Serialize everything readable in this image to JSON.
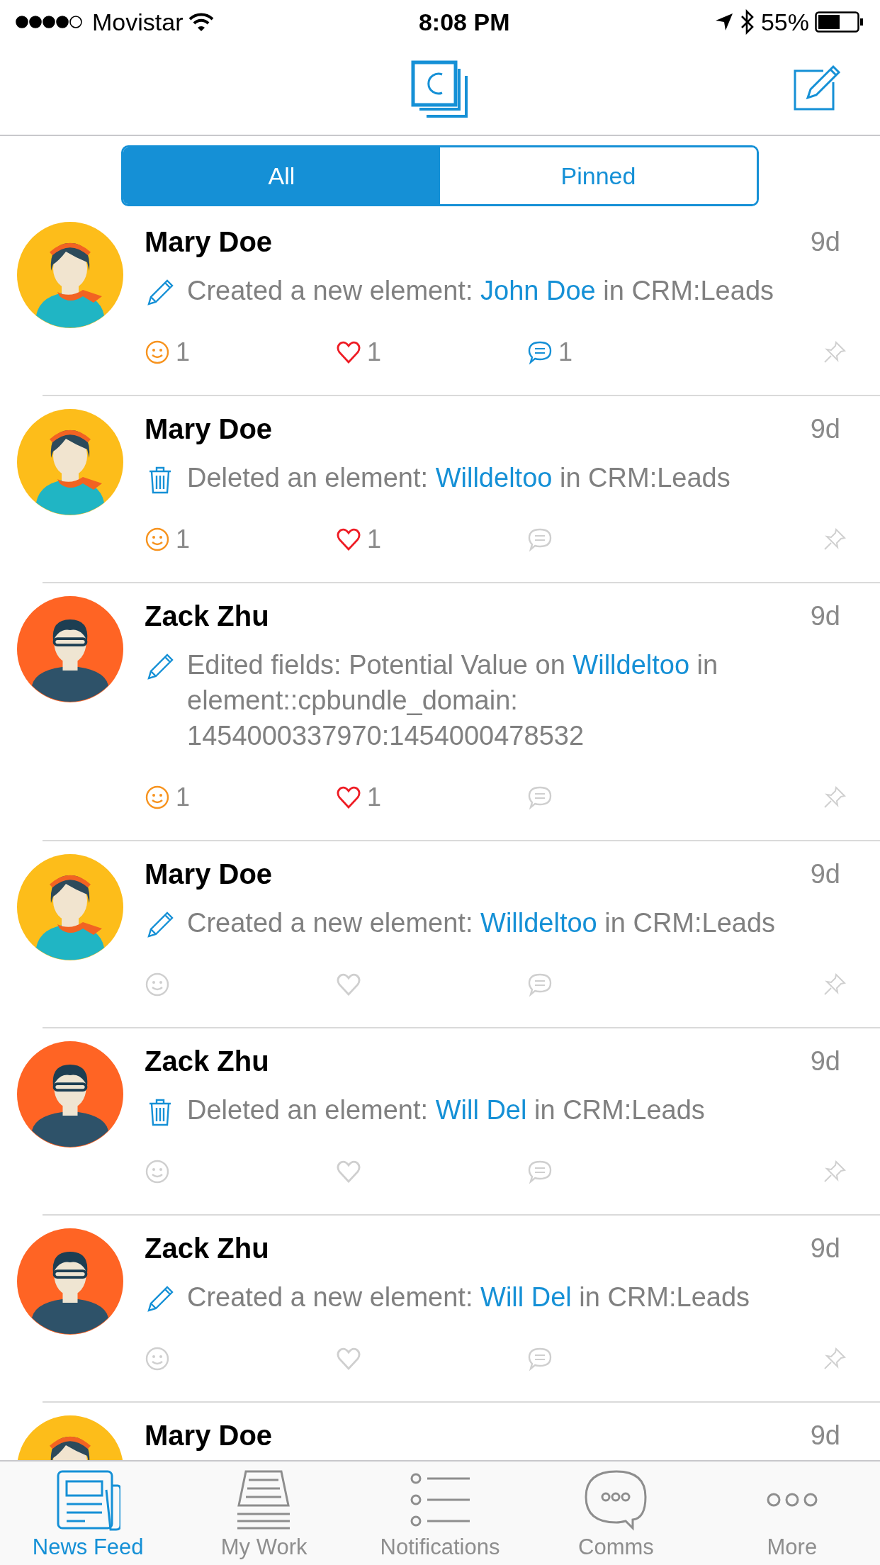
{
  "status_bar": {
    "carrier": "Movistar",
    "time": "8:08 PM",
    "battery": "55%"
  },
  "segments": [
    {
      "label": "All",
      "selected": true
    },
    {
      "label": "Pinned",
      "selected": false
    }
  ],
  "feed": [
    {
      "author": "Mary Doe",
      "avatar": {
        "kind": "woman"
      },
      "time": "9d",
      "activity": {
        "kind": "edit",
        "before": "Created a new element: ",
        "link": "John Doe",
        "after": " in CRM:Leads"
      },
      "reactions": [
        {
          "kind": "smile",
          "active": true,
          "count": "1"
        },
        {
          "kind": "heart",
          "active": true,
          "count": "1"
        },
        {
          "kind": "comment",
          "active": true,
          "count": "1"
        },
        {
          "kind": "pin",
          "active": false
        }
      ]
    },
    {
      "author": "Mary Doe",
      "avatar": {
        "kind": "woman"
      },
      "time": "9d",
      "activity": {
        "kind": "delete",
        "before": "Deleted an element: ",
        "link": "Willdeltoo",
        "after": " in CRM:Leads"
      },
      "reactions": [
        {
          "kind": "smile",
          "active": true,
          "count": "1"
        },
        {
          "kind": "heart",
          "active": true,
          "count": "1"
        },
        {
          "kind": "comment",
          "active": false
        },
        {
          "kind": "pin",
          "active": false
        }
      ]
    },
    {
      "author": "Zack Zhu",
      "avatar": {
        "kind": "man"
      },
      "time": "9d",
      "activity": {
        "kind": "edit",
        "before": "Edited fields: Potential Value on ",
        "link": "Willdeltoo",
        "after": " in element::cpbundle_domain: 1454000337970:1454000478532"
      },
      "reactions": [
        {
          "kind": "smile",
          "active": true,
          "count": "1"
        },
        {
          "kind": "heart",
          "active": true,
          "count": "1"
        },
        {
          "kind": "comment",
          "active": false
        },
        {
          "kind": "pin",
          "active": false
        }
      ]
    },
    {
      "author": "Mary Doe",
      "avatar": {
        "kind": "woman"
      },
      "time": "9d",
      "activity": {
        "kind": "edit",
        "before": "Created a new element: ",
        "link": "Willdeltoo",
        "after": " in CRM:Leads"
      },
      "reactions": [
        {
          "kind": "smile",
          "active": false
        },
        {
          "kind": "heart",
          "active": false
        },
        {
          "kind": "comment",
          "active": false
        },
        {
          "kind": "pin",
          "active": false
        }
      ]
    },
    {
      "author": "Zack Zhu",
      "avatar": {
        "kind": "man"
      },
      "time": "9d",
      "activity": {
        "kind": "delete",
        "before": "Deleted an element: ",
        "link": "Will Del",
        "after": " in CRM:Leads"
      },
      "reactions": [
        {
          "kind": "smile",
          "active": false
        },
        {
          "kind": "heart",
          "active": false
        },
        {
          "kind": "comment",
          "active": false
        },
        {
          "kind": "pin",
          "active": false
        }
      ]
    },
    {
      "author": "Zack Zhu",
      "avatar": {
        "kind": "man"
      },
      "time": "9d",
      "activity": {
        "kind": "edit",
        "before": "Created a new element: ",
        "link": "Will Del",
        "after": " in CRM:Leads"
      },
      "reactions": [
        {
          "kind": "smile",
          "active": false
        },
        {
          "kind": "heart",
          "active": false
        },
        {
          "kind": "comment",
          "active": false
        },
        {
          "kind": "pin",
          "active": false
        }
      ]
    },
    {
      "author": "Mary Doe",
      "avatar": {
        "kind": "woman"
      },
      "time": "9d"
    }
  ],
  "tab_bar": [
    {
      "label": "News Feed",
      "selected": true
    },
    {
      "label": "My Work",
      "selected": false
    },
    {
      "label": "Notifications",
      "selected": false
    },
    {
      "label": "Comms",
      "selected": false
    },
    {
      "label": "More",
      "selected": false
    }
  ]
}
